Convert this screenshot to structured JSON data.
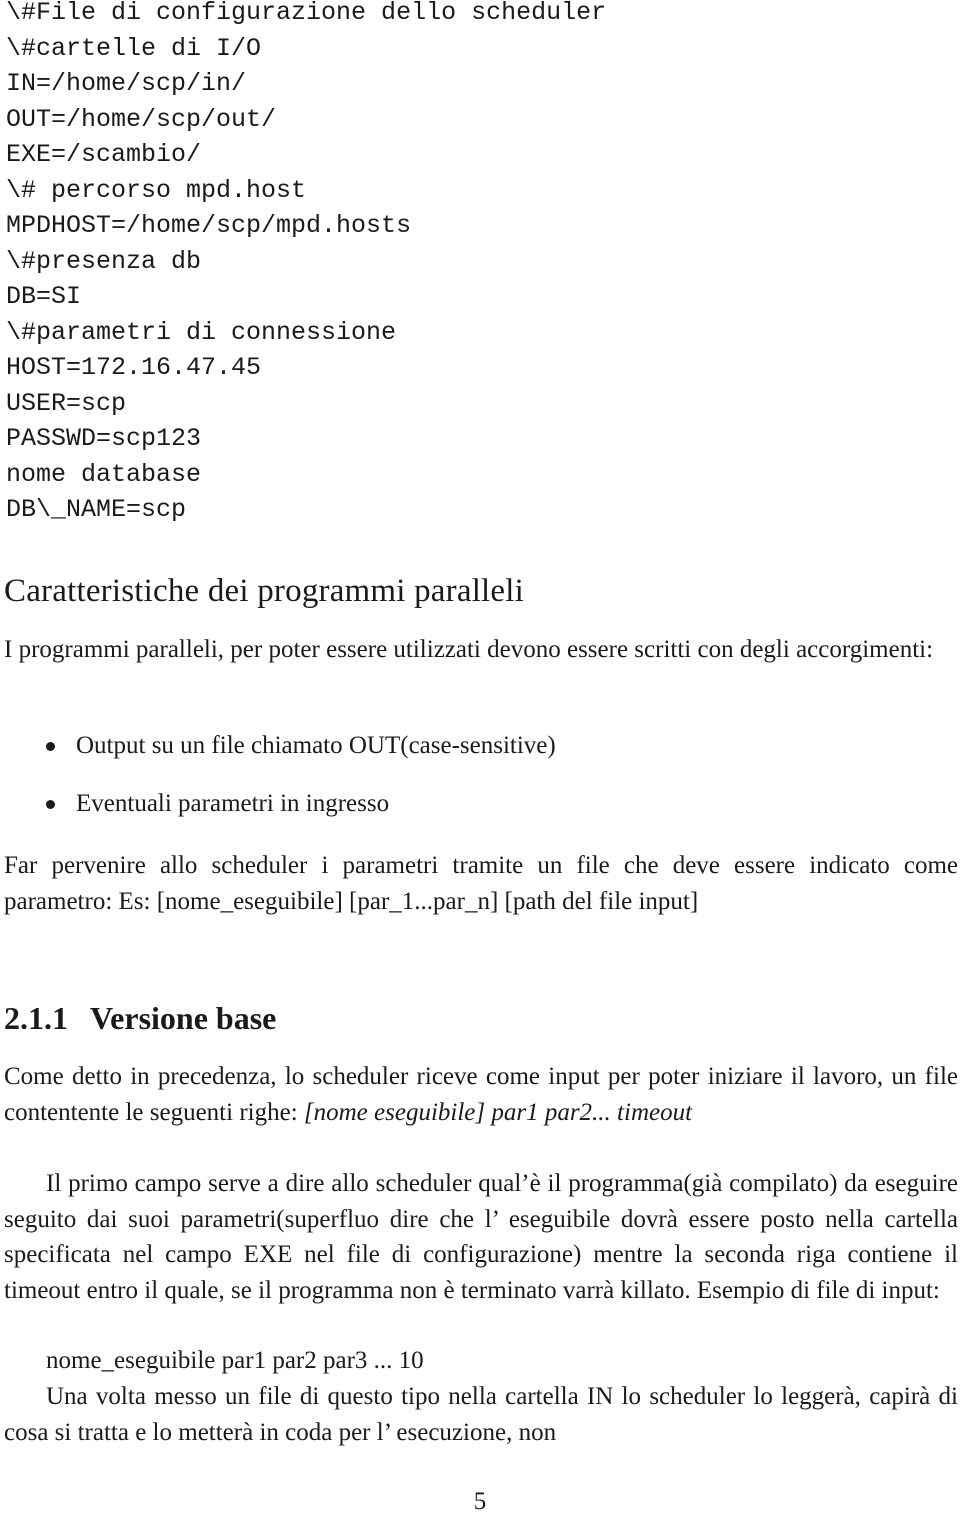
{
  "config_listing": {
    "lines": [
      "\\#File di configurazione dello scheduler",
      "\\#cartelle di I/O",
      "IN=/home/scp/in/",
      "OUT=/home/scp/out/",
      "EXE=/scambio/",
      "\\# percorso mpd.host",
      "MPDHOST=/home/scp/mpd.hosts",
      "\\#presenza db",
      "DB=SI",
      "\\#parametri di connessione",
      "HOST=172.16.47.45",
      "USER=scp",
      "PASSWD=scp123",
      "nome database",
      "DB\\_NAME=scp"
    ]
  },
  "section": {
    "title": "Caratteristiche dei programmi paralleli",
    "intro": "I programmi paralleli, per poter essere utilizzati devono essere scritti con degli accorgimenti:",
    "bullets": [
      "Output su un file chiamato OUT(case-sensitive)",
      "Eventuali parametri in ingresso"
    ],
    "after_bullets": "Far pervenire allo scheduler i parametri tramite un file che deve essere indicato come parametro: Es: [nome_eseguibile] [par_1...par_n] [path del file input]"
  },
  "subsection": {
    "number": "2.1.1",
    "title": "Versione base",
    "p1_text": "Come detto in precedenza, lo scheduler riceve come input per poter iniziare il lavoro, un file contentente le seguenti righe: ",
    "p1_italic": "[nome eseguibile] par1 par2... timeout",
    "p2": "Il primo campo serve a dire allo scheduler qual’è il programma(già compilato) da eseguire seguito dai suoi parametri(superfluo dire che l’ eseguibile dovrà essere posto nella cartella specificata nel campo EXE nel file di configurazione) mentre la seconda riga contiene il timeout entro il quale, se il programma non è terminato varrà killato. Esempio di file di input:",
    "example": "nome_eseguibile par1 par2 par3 ... 10",
    "p3": "Una volta messo un file di questo tipo nella cartella IN lo scheduler lo leggerà, capirà di cosa si tratta e lo metterà in coda per l’ esecuzione, non"
  },
  "page_number": "5"
}
